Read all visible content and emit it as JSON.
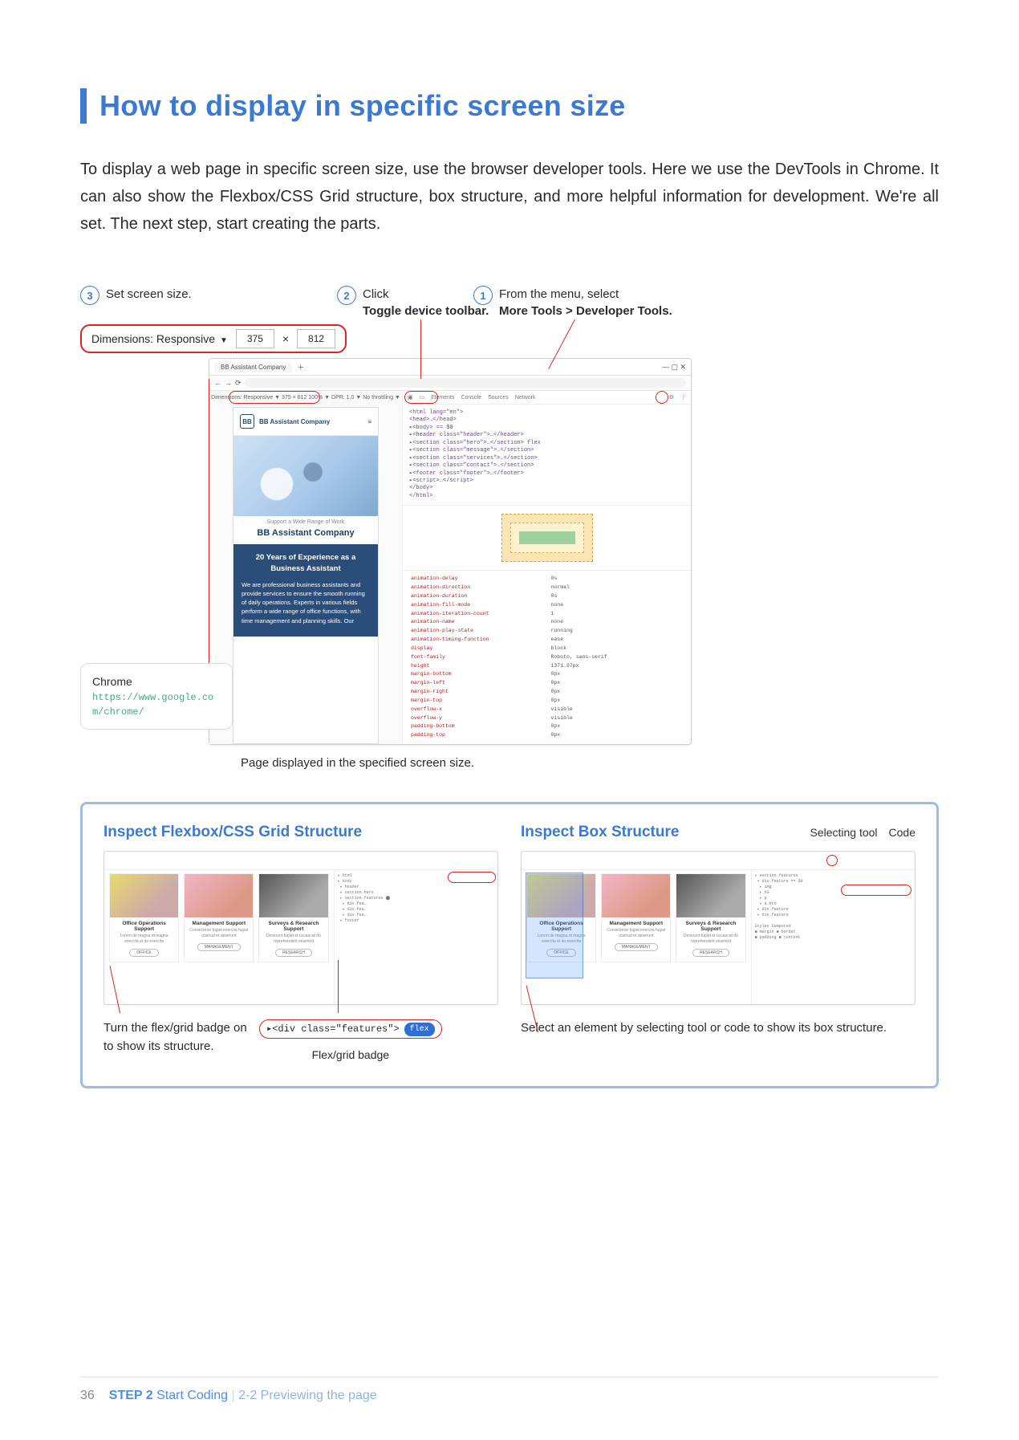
{
  "title": "How to display in specific screen size",
  "intro": "To display a web page in specific screen size, use the browser developer tools. Here we use the DevTools in Chrome. It can also show the Flexbox/CSS Grid structure, box structure, and more helpful information for development. We're all set. The next step, start creating the parts.",
  "callouts": {
    "c3": {
      "num": "3",
      "text": "Set screen size."
    },
    "c2": {
      "num": "2",
      "text": "Click",
      "bold": "Toggle device toolbar."
    },
    "c1": {
      "num": "1",
      "text": "From the menu, select",
      "bold": "More Tools > Developer Tools."
    }
  },
  "dimensions_bar": {
    "label": "Dimensions: Responsive",
    "caret": "▼",
    "w": "375",
    "x": "×",
    "h": "812"
  },
  "screenshot": {
    "tab": "BB Assistant Company",
    "dimbar": "Dimensions: Responsive ▼  375 × 812   100% ▼  DPR: 1.0 ▼  No throttling ▼",
    "logo_sub": "BB Assistant Company",
    "hero_caption": "Support a Wide Range of Work",
    "hero_h": "BB Assistant Company",
    "band_title": "20 Years of Experience as a Business Assistant",
    "band_body": "We are professional business assistants and provide services to ensure the smooth running of daily operations. Experts in various fields perform a wide range of office functions, with time management and planning skills. Our",
    "dev_tabs": [
      "Elements",
      "Console",
      "Sources",
      "Network"
    ],
    "code_lines": [
      "<html lang=\"en\">",
      " <head>…</head>",
      " ▸<body> == $0",
      "  ▸<header class=\"header\">…</header>",
      "  ▸<section class=\"hero\">…</section> flex",
      "  ▸<section class=\"message\">…</section>",
      "  ▸<section class=\"services\">…</section>",
      "  ▸<section class=\"contact\">…</section>",
      "  ▸<footer class=\"footer\">…</footer>",
      "  ▸<script>…</script>",
      " </body>",
      "</html>"
    ],
    "styles": [
      "animation-delay",
      "0s",
      "animation-direction",
      "normal",
      "animation-duration",
      "0s",
      "animation-fill-mode",
      "none",
      "animation-iteration-count",
      "1",
      "animation-name",
      "none",
      "animation-play-state",
      "running",
      "animation-timing-function",
      "ease",
      "display",
      "block",
      "font-family",
      "Roboto, sans-serif",
      "height",
      "1371.97px",
      "margin-bottom",
      "0px",
      "margin-left",
      "0px",
      "margin-right",
      "0px",
      "margin-top",
      "0px",
      "overflow-x",
      "visible",
      "overflow-y",
      "visible",
      "padding-bottom",
      "0px",
      "padding-top",
      "0px"
    ]
  },
  "below_caption": "Page displayed in the specified screen size.",
  "chrome_card": {
    "title": "Chrome",
    "url": "https://www.google.com/chrome/"
  },
  "panel": {
    "left_h": "Inspect Flexbox/CSS Grid Structure",
    "right_h": "Inspect Box Structure",
    "right_sub1": "Selecting tool",
    "right_sub2": "Code",
    "cards": [
      {
        "t": "Office Operations Support",
        "d": "Lorem de magna et magna exercita et do exercita",
        "b": "OFFICE"
      },
      {
        "t": "Management Support",
        "d": "Consectetur fugiat exercita fugiat nostrud et deserunt",
        "b": "MANAGEMENT"
      },
      {
        "t": "Surveys & Research Support",
        "d": "Deserunt fugiat et occaecat do reprehenderit eiusmod",
        "b": "RESEARCH"
      }
    ],
    "left_caption": "Turn the flex/grid badge on to show its structure.",
    "right_caption": "Select an element by selecting tool or code to show its box structure.",
    "badge_code": "▸<div class=\"features\">",
    "badge_pill": "flex",
    "badge_label": "Flex/grid badge"
  },
  "footer": {
    "page": "36",
    "step": "STEP 2",
    "section": "Start Coding",
    "bar": "|",
    "sub": "2-2  Previewing the page"
  }
}
